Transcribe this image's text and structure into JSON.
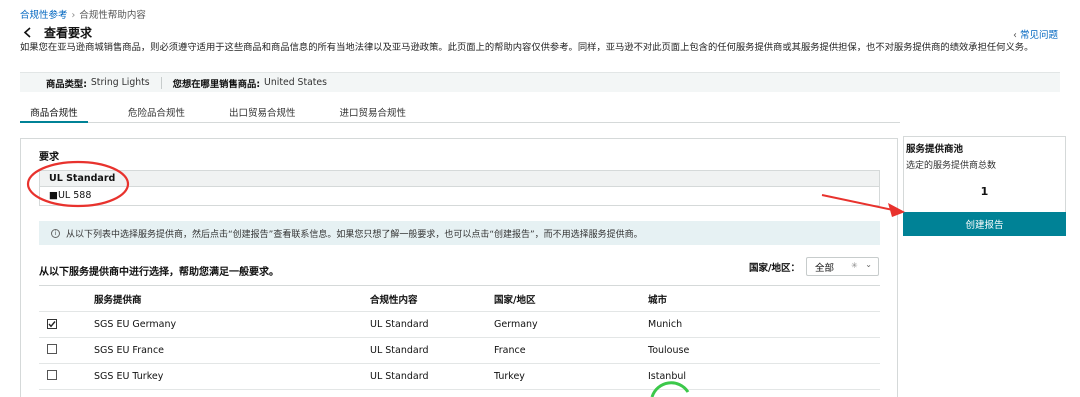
{
  "breadcrumb": {
    "parent": "合规性参考",
    "current": "合规性帮助内容"
  },
  "page_title": "查看要求",
  "faq_link": "常见问题",
  "disclaimer": "如果您在亚马逊商城销售商品，则必须遵守适用于这些商品和商品信息的所有当地法律以及亚马逊政策。此页面上的帮助内容仅供参考。同样，亚马逊不对此页面上包含的任何服务提供商或其服务提供担保，也不对服务提供商的绩效承担任何义务。",
  "product_bar": {
    "type_label": "商品类型:",
    "type_value": "String Lights",
    "where_label": "您想在哪里销售商品:",
    "where_value": "United States"
  },
  "tabs": [
    {
      "label": "商品合规性",
      "active": true
    },
    {
      "label": "危险品合规性",
      "active": false
    },
    {
      "label": "出口贸易合规性",
      "active": false
    },
    {
      "label": "进口贸易合规性",
      "active": false
    }
  ],
  "requirements": {
    "title": "要求",
    "standard_header": "UL Standard",
    "standard_value": "■UL 588"
  },
  "info_text": "从以下列表中选择服务提供商，然后点击“创建报告”查看联系信息。如果您只想了解一般要求，也可以点击“创建报告”，而不用选择服务提供商。",
  "select_prompt": "从以下服务提供商中进行选择，帮助您满足一般要求。",
  "country_filter": {
    "label": "国家/地区：",
    "selected": "全部"
  },
  "provider_table": {
    "headers": [
      "服务提供商",
      "合规性内容",
      "国家/地区",
      "城市"
    ],
    "rows": [
      {
        "checked": true,
        "name": "SGS EU Germany",
        "content": "UL Standard",
        "region": "Germany",
        "city": "Munich"
      },
      {
        "checked": false,
        "name": "SGS EU France",
        "content": "UL Standard",
        "region": "France",
        "city": "Toulouse"
      },
      {
        "checked": false,
        "name": "SGS EU Turkey",
        "content": "UL Standard",
        "region": "Turkey",
        "city": "Istanbul"
      }
    ]
  },
  "side_panel": {
    "title": "服务提供商池",
    "subtitle": "选定的服务提供商总数",
    "count": "1",
    "create_button": "创建报告"
  },
  "colors": {
    "accent": "#008296",
    "link": "#0066c0",
    "annotation": "#e8322d",
    "info_bg": "#e6f1f3"
  },
  "icons": {
    "back": "chevron-left-icon",
    "faq": "chevron-left-icon",
    "info": "info-icon",
    "country": "globe-icon",
    "caret": "chevron-down-icon",
    "check": "checkmark-icon"
  }
}
